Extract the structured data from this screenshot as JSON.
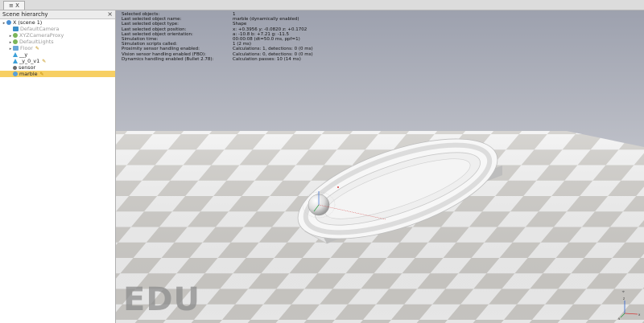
{
  "tabbar": {
    "tab_label": "≡ X"
  },
  "sidebar": {
    "header": "Scene hierarchy",
    "close_label": "×",
    "items": [
      {
        "label": "X (scene 1)",
        "icon": "world-icon",
        "depth": 0,
        "expander": "▸",
        "dim": false,
        "selected": false,
        "mark": ""
      },
      {
        "label": "DefaultCamera",
        "icon": "camera-icon",
        "depth": 1,
        "expander": "",
        "dim": true,
        "selected": false,
        "mark": ""
      },
      {
        "label": "XYZCameraProxy",
        "icon": "group-icon",
        "depth": 1,
        "expander": "▸",
        "dim": true,
        "selected": false,
        "mark": ""
      },
      {
        "label": "DefaultLights",
        "icon": "group-icon",
        "depth": 1,
        "expander": "▸",
        "dim": true,
        "selected": false,
        "mark": ""
      },
      {
        "label": "Floor",
        "icon": "floor-icon",
        "depth": 1,
        "expander": "▸",
        "dim": true,
        "selected": false,
        "mark": "script"
      },
      {
        "label": "__y",
        "icon": "drop-icon",
        "depth": 1,
        "expander": "",
        "dim": false,
        "selected": false,
        "mark": ""
      },
      {
        "label": "_y_0_v1",
        "icon": "drop-icon",
        "depth": 1,
        "expander": "",
        "dim": false,
        "selected": false,
        "mark": "script"
      },
      {
        "label": "sensor",
        "icon": "sensor-icon",
        "depth": 1,
        "expander": "",
        "dim": false,
        "selected": false,
        "mark": ""
      },
      {
        "label": "marble",
        "icon": "ball-icon",
        "depth": 1,
        "expander": "",
        "dim": false,
        "selected": true,
        "mark": "script"
      }
    ]
  },
  "viewport": {
    "info_rows": [
      {
        "key": "Selected objects:",
        "value": "1"
      },
      {
        "key": "Last selected object name:",
        "value": "marble   (dynamically enabled)"
      },
      {
        "key": "Last selected object type:",
        "value": "Shape"
      },
      {
        "key": "Last selected object position:",
        "value": "x: +0.3956   y: -0.0820   z: +0.1702"
      },
      {
        "key": "Last selected object orientation:",
        "value": "a: -10.8   b: +7.21   g: -11.5"
      },
      {
        "key": "Simulation time:",
        "value": "00:00:08 (dt=50.0 ms, ppf=1)"
      },
      {
        "key": "Simulation scripts called:",
        "value": "1 (2 ms)"
      },
      {
        "key": "Proximity sensor handling enabled:",
        "value": "Calculations: 1, detections: 0 (0 ms)"
      },
      {
        "key": "Vision sensor handling enabled (FBO):",
        "value": "Calculations: 0, detections: 0 (0 ms)"
      },
      {
        "key": "Dynamics handling enabled (Bullet 2.78):",
        "value": "Calculation passes: 10 (14 ms)"
      }
    ],
    "watermark": "EDU"
  },
  "colors": {
    "accent_selected": "#f7cf63",
    "sky_top": "#9da1ae",
    "sky_bottom": "#e6e6e8",
    "floor_light": "#f2f2f2",
    "floor_dark": "#cfcdc9"
  }
}
